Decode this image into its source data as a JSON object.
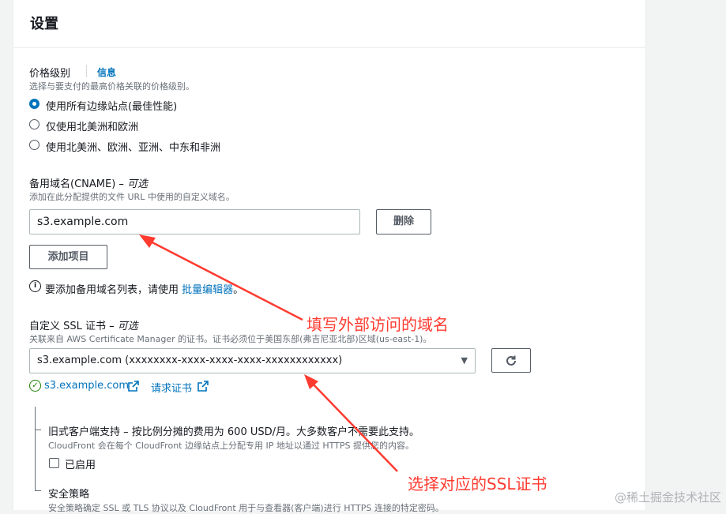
{
  "settings": {
    "title": "设置",
    "price_class": {
      "label": "价格级别",
      "info": "信息",
      "desc": "选择与要支付的最高价格关联的价格级别。",
      "options": [
        {
          "label": "使用所有边缘站点(最佳性能)",
          "selected": true
        },
        {
          "label": "仅使用北美洲和欧洲",
          "selected": false
        },
        {
          "label": "使用北美洲、欧洲、亚洲、中东和非洲",
          "selected": false
        }
      ]
    },
    "cname": {
      "label": "备用域名(CNAME)",
      "optional": "– 可选",
      "desc": "添加在此分配提供的文件 URL 中使用的自定义域名。",
      "value": "s3.example.com",
      "remove_button": "删除",
      "add_button": "添加项目",
      "note_prefix": "要添加备用域名列表，请使用",
      "note_link": "批量编辑器",
      "note_suffix": "。"
    },
    "ssl": {
      "label": "自定义 SSL 证书",
      "optional": "– 可选",
      "desc": "关联来自 AWS Certificate Manager 的证书。证书必须位于美国东部(弗吉尼亚北部)区域(us-east-1)。",
      "value": "s3.example.com (xxxxxxxx-xxxx-xxxx-xxxx-xxxxxxxxxxxx)",
      "cert_link": "s3.example.com",
      "request_link": "请求证书"
    },
    "legacy": {
      "label": "旧式客户端支持 – 按比例分摊的费用为 600 USD/月。大多数客户不需要此支持。",
      "desc": "CloudFront 会在每个 CloudFront 边缘站点上分配专用 IP 地址以通过 HTTPS 提供您的内容。",
      "checkbox_label": "已启用",
      "checked": false
    },
    "security_policy": {
      "label": "安全策略",
      "desc": "安全策略确定 SSL 或 TLS 协议以及 CloudFront 用于与查看器(客户端)进行 HTTPS 连接的特定密码。"
    }
  },
  "annotations": {
    "domain_note": "填写外部访问的域名",
    "ssl_note": "选择对应的SSL证书",
    "color": "#ff3b30"
  },
  "watermark": "@稀土掘金技术社区"
}
